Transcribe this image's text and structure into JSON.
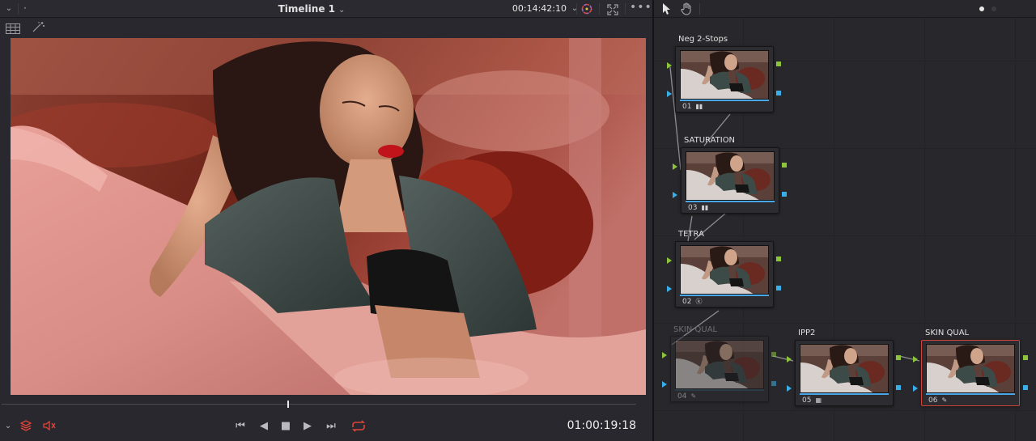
{
  "viewer": {
    "timeline_title": "Timeline 1",
    "source_timecode": "00:14:42:10",
    "record_timecode": "01:00:19:18",
    "playhead_fraction": 0.45
  },
  "nodes": [
    {
      "label": "Neg 2-Stops",
      "number": "01",
      "icon": "histogram-icon"
    },
    {
      "label": "SATURATION",
      "number": "03",
      "icon": "histogram-icon"
    },
    {
      "label": "TETRA",
      "number": "02",
      "icon": "circle-k-icon"
    },
    {
      "label": "SKIN QUAL",
      "number": "04",
      "icon": "eyedropper-icon",
      "state": "disabled"
    },
    {
      "label": "IPP2",
      "number": "05",
      "icon": "grid-icon"
    },
    {
      "label": "SKIN QUAL",
      "number": "06",
      "icon": "eyedropper-icon",
      "state": "selected"
    }
  ],
  "colors": {
    "accent_red": "#e0443a",
    "port_green": "#8cc43c",
    "port_blue": "#3aaee8",
    "selected_border": "#d0453a"
  }
}
